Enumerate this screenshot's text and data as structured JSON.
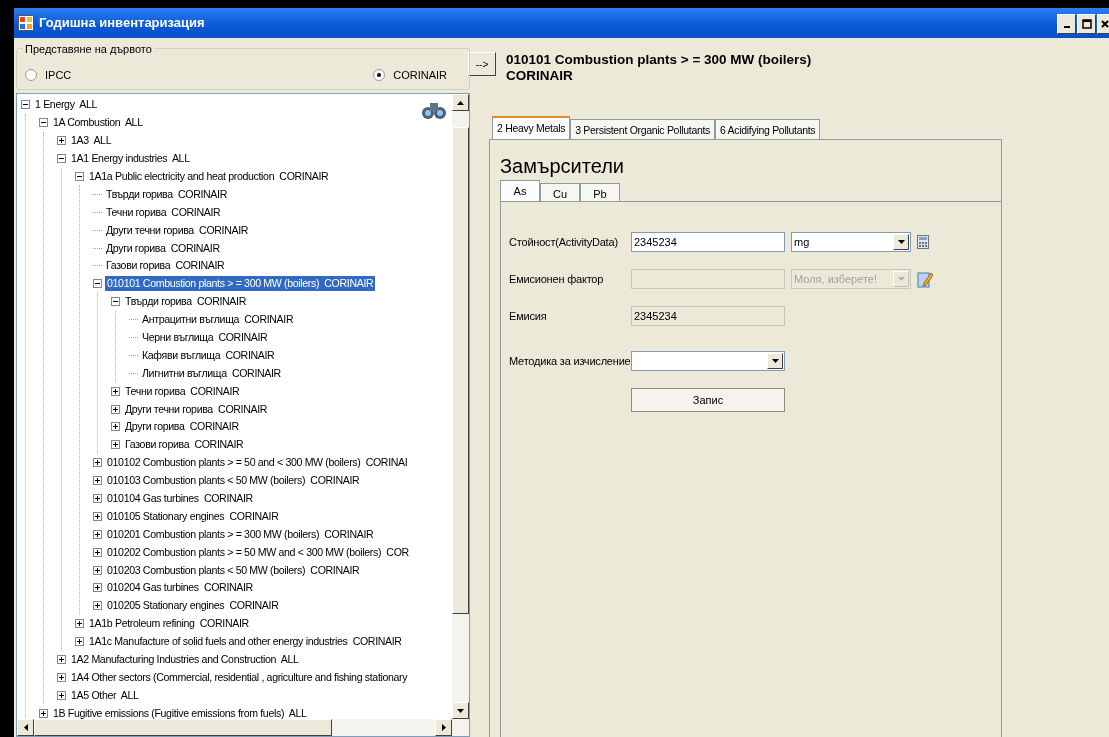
{
  "window": {
    "title": "Годишна инвентаризация"
  },
  "tree_view": {
    "label": "Представяне на дървото",
    "options": [
      {
        "label": "IPCC",
        "selected": false
      },
      {
        "label": "CORINAIR",
        "selected": true
      }
    ]
  },
  "tree": {
    "nodes": [
      {
        "label": "1 Energy  ALL",
        "expanded": true,
        "selected": false,
        "children": [
          {
            "label": "1A Combustion  ALL",
            "expanded": true,
            "selected": false,
            "children": [
              {
                "label": "1A3  ALL",
                "expanded": false,
                "selected": false
              },
              {
                "label": "1A1 Energy industries  ALL",
                "expanded": true,
                "selected": false,
                "children": [
                  {
                    "label": "1A1a Public electricity and heat production  CORINAIR",
                    "expanded": true,
                    "selected": false,
                    "children": [
                      {
                        "label": "Твърди горива  CORINAIR",
                        "selected": false
                      },
                      {
                        "label": "Течни горива  CORINAIR",
                        "selected": false
                      },
                      {
                        "label": "Други течни горива  CORINAIR",
                        "selected": false
                      },
                      {
                        "label": "Други горива  CORINAIR",
                        "selected": false
                      },
                      {
                        "label": "Газови горива  CORINAIR",
                        "selected": false
                      },
                      {
                        "label": "010101 Combustion plants > = 300 MW (boilers)  CORINAIR",
                        "expanded": true,
                        "selected": true,
                        "children": [
                          {
                            "label": "Твърди горива  CORINAIR",
                            "expanded": true,
                            "selected": false,
                            "children": [
                              {
                                "label": "Антрацитни въглища  CORINAIR",
                                "selected": false
                              },
                              {
                                "label": "Черни въглища  CORINAIR",
                                "selected": false
                              },
                              {
                                "label": "Кафяви въглища  CORINAIR",
                                "selected": false
                              },
                              {
                                "label": "Лигнитни въглища  CORINAIR",
                                "selected": false
                              }
                            ]
                          },
                          {
                            "label": "Течни горива  CORINAIR",
                            "expanded": false,
                            "selected": false
                          },
                          {
                            "label": "Други течни горива  CORINAIR",
                            "expanded": false,
                            "selected": false
                          },
                          {
                            "label": "Други горива  CORINAIR",
                            "expanded": false,
                            "selected": false
                          },
                          {
                            "label": "Газови горива  CORINAIR",
                            "expanded": false,
                            "selected": false
                          }
                        ]
                      },
                      {
                        "label": "010102 Combustion plants > = 50 and < 300 MW (boilers)  CORINAI",
                        "expanded": false,
                        "selected": false
                      },
                      {
                        "label": "010103 Combustion plants < 50 MW (boilers)  CORINAIR",
                        "expanded": false,
                        "selected": false
                      },
                      {
                        "label": "010104 Gas turbines  CORINAIR",
                        "expanded": false,
                        "selected": false
                      },
                      {
                        "label": "010105 Stationary engines  CORINAIR",
                        "expanded": false,
                        "selected": false
                      },
                      {
                        "label": "010201 Combustion plants > = 300 MW (boilers)  CORINAIR",
                        "expanded": false,
                        "selected": false
                      },
                      {
                        "label": "010202 Combustion plants > = 50 MW and < 300 MW (boilers)  COR",
                        "expanded": false,
                        "selected": false
                      },
                      {
                        "label": "010203 Combustion plants < 50 MW (boilers)  CORINAIR",
                        "expanded": false,
                        "selected": false
                      },
                      {
                        "label": "010204 Gas turbines  CORINAIR",
                        "expanded": false,
                        "selected": false
                      },
                      {
                        "label": "010205 Stationary engines  CORINAIR",
                        "expanded": false,
                        "selected": false
                      }
                    ]
                  },
                  {
                    "label": "1A1b Petroleum refining  CORINAIR",
                    "expanded": false,
                    "selected": false
                  },
                  {
                    "label": "1A1c Manufacture of solid fuels and other energy industries  CORINAIR",
                    "expanded": false,
                    "selected": false
                  }
                ]
              },
              {
                "label": "1A2 Manufacturing Industries and Construction  ALL",
                "expanded": false,
                "selected": false
              },
              {
                "label": "1A4 Other sectors (Commercial, residential , agriculture and fishing stationary",
                "expanded": false,
                "selected": false
              },
              {
                "label": "1A5 Other  ALL",
                "expanded": false,
                "selected": false
              }
            ]
          },
          {
            "label": "1B Fugitive emissions (Fugitive emissions from fuels)  ALL",
            "expanded": false,
            "selected": false
          }
        ]
      }
    ]
  },
  "go_button": "-->",
  "heading": "010101 Combustion plants > = 300 MW (boilers)\nCORINAIR",
  "tabs": [
    {
      "label": "2 Heavy Metals",
      "selected": true
    },
    {
      "label": "3 Persistent Organic Pollutants",
      "selected": false
    },
    {
      "label": "6 Acidifying Pollutants",
      "selected": false
    }
  ],
  "pollutants_title": "Замърсители",
  "pollutant_tabs": [
    {
      "label": "As",
      "selected": true
    },
    {
      "label": "Cu",
      "selected": false
    },
    {
      "label": "Pb",
      "selected": false
    }
  ],
  "fields": [
    {
      "kind": "measure",
      "label": "Стойност(ActivityData)",
      "value": "2345234",
      "disabled": false,
      "unit": "mg",
      "unit_disabled": false
    },
    {
      "kind": "factor",
      "label": "Емисионен фактор",
      "disabled": true,
      "unit": "Моля, изберете!",
      "unit_disabled": true
    },
    {
      "kind": "readonly",
      "label": "Емисия",
      "value": "2345234"
    },
    {
      "kind": "select",
      "label": "Методика за изчисление",
      "disabled": false
    }
  ],
  "save_button": "Запис"
}
